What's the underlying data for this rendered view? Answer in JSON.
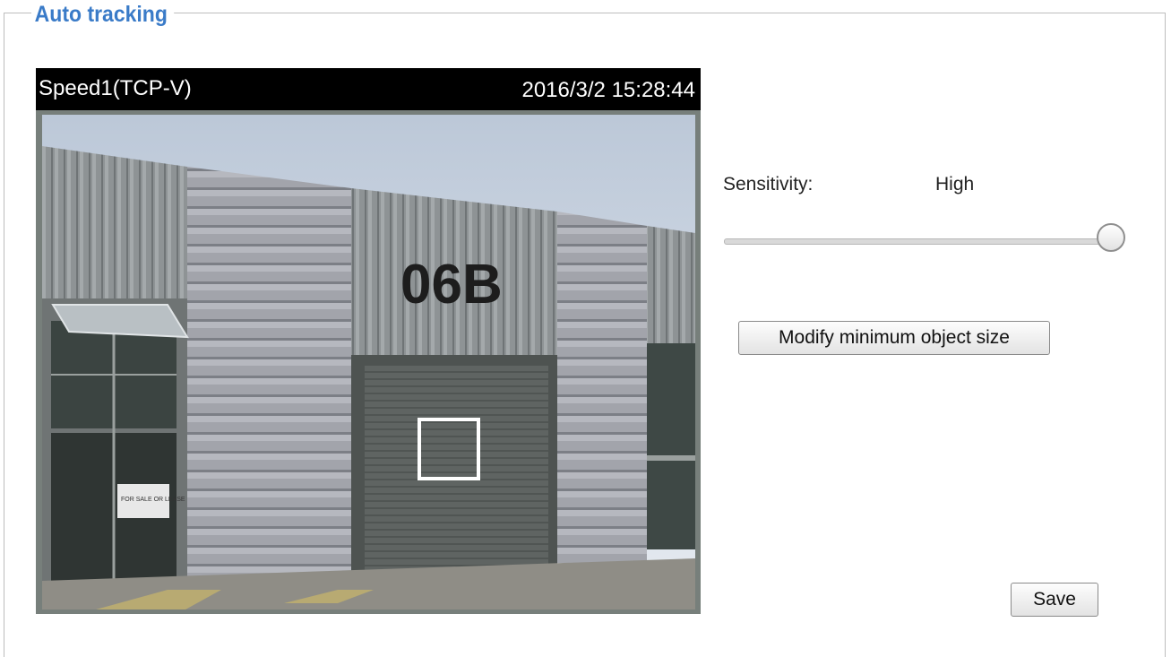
{
  "section": {
    "legend": "Auto tracking"
  },
  "video": {
    "title": "Speed1(TCP-V)",
    "timestamp": "2016/3/2 15:28:44",
    "image": {
      "building_label": "06B",
      "sign_text": "FOR SALE OR LEASE"
    }
  },
  "sensitivity": {
    "label": "Sensitivity:",
    "value": "High",
    "level": 1.0
  },
  "buttons": {
    "modify_label": "Modify minimum object size",
    "save_label": "Save"
  },
  "colors": {
    "legend": "#3a7bc8",
    "video_header_bg": "#000000",
    "tracking_box": "#ffffff"
  }
}
